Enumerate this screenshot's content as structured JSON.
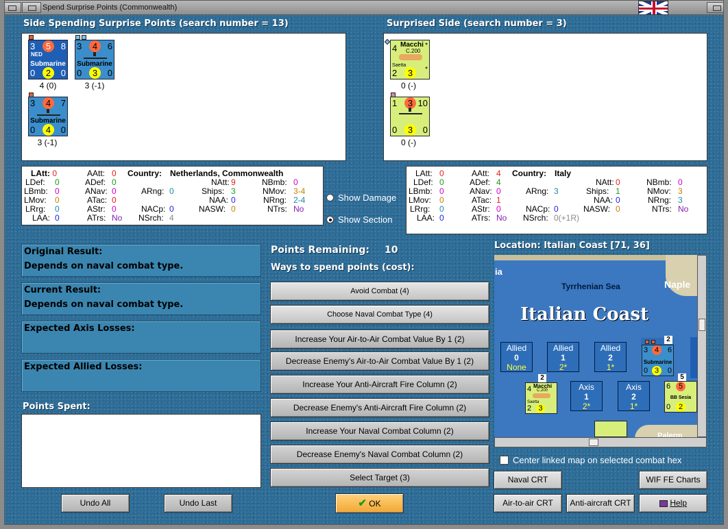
{
  "window": {
    "title": "Spend Surprise Points (Commonwealth)"
  },
  "left": {
    "header": "Side Spending Surprise Points (search number = 13)",
    "units": [
      {
        "tl": "3",
        "tc": "5",
        "tr": "8",
        "bl": "0",
        "bc": "2",
        "br": "0",
        "tag": "NED",
        "name": "Submarine",
        "label": "4 (0)"
      },
      {
        "tl": "3",
        "tc": "4",
        "tr": "6",
        "bl": "0",
        "bc": "3",
        "br": "0",
        "tag": "",
        "name": "Submarine",
        "label": "3 (-1)"
      },
      {
        "tl": "3",
        "tc": "4",
        "tr": "7",
        "bl": "0",
        "bc": "4",
        "br": "0",
        "tag": "",
        "name": "Submarine",
        "label": "3 (-1)"
      }
    ]
  },
  "right": {
    "header": "Surprised Side (search number = 3)",
    "units": [
      {
        "tl": "4",
        "name": "Macchi",
        "model": "C.200",
        "sub": "Saetta",
        "bl": "2",
        "bc": "3",
        "star": "*",
        "label": "0 (-)"
      },
      {
        "tl": "1",
        "tc": "3",
        "tr": "10",
        "bl": "0",
        "bc": "3",
        "br": "0",
        "label": "0 (-)"
      }
    ]
  },
  "statsLeft": {
    "country_label": "Country:",
    "country": "Netherlands, Commonwealth",
    "rows": [
      {
        "k": "LAtt:",
        "v": "0"
      },
      {
        "k": "LDef:",
        "v": "0"
      },
      {
        "k": "LBmb:",
        "v": "0"
      },
      {
        "k": "LMov:",
        "v": "0"
      },
      {
        "k": "LRrg:",
        "v": "0"
      },
      {
        "k": "LAA:",
        "v": "0"
      },
      {
        "k": "AAtt:",
        "v": "0"
      },
      {
        "k": "ADef:",
        "v": "0"
      },
      {
        "k": "ANav:",
        "v": "0"
      },
      {
        "k": "ATac:",
        "v": "0"
      },
      {
        "k": "AStr:",
        "v": "0"
      },
      {
        "k": "ATrs:",
        "v": "No"
      },
      {
        "k": "ARng:",
        "v": "0"
      },
      {
        "k": "NACp:",
        "v": "0"
      },
      {
        "k": "NSrch:",
        "v": "4"
      },
      {
        "k": "NAtt:",
        "v": "9"
      },
      {
        "k": "Ships:",
        "v": "3"
      },
      {
        "k": "NAA:",
        "v": "0"
      },
      {
        "k": "NASW:",
        "v": "0"
      },
      {
        "k": "NBmb:",
        "v": "0"
      },
      {
        "k": "NMov:",
        "v": "3-4"
      },
      {
        "k": "NRng:",
        "v": "2-4"
      },
      {
        "k": "NTrs:",
        "v": "No"
      }
    ]
  },
  "statsRight": {
    "country_label": "Country:",
    "country": "Italy",
    "rows": [
      {
        "k": "LAtt:",
        "v": "0"
      },
      {
        "k": "LDef:",
        "v": "0"
      },
      {
        "k": "LBmb:",
        "v": "0"
      },
      {
        "k": "LMov:",
        "v": "0"
      },
      {
        "k": "LRrg:",
        "v": "0"
      },
      {
        "k": "LAA:",
        "v": "0"
      },
      {
        "k": "AAtt:",
        "v": "4"
      },
      {
        "k": "ADef:",
        "v": "4"
      },
      {
        "k": "ANav:",
        "v": "0"
      },
      {
        "k": "ATac:",
        "v": "1"
      },
      {
        "k": "AStr:",
        "v": "0"
      },
      {
        "k": "ATrs:",
        "v": "No"
      },
      {
        "k": "ARng:",
        "v": "3"
      },
      {
        "k": "NACp:",
        "v": "0"
      },
      {
        "k": "NSrch:",
        "v": "0(+1R)"
      },
      {
        "k": "NAtt:",
        "v": "0"
      },
      {
        "k": "Ships:",
        "v": "1"
      },
      {
        "k": "NAA:",
        "v": "0"
      },
      {
        "k": "NASW:",
        "v": "0"
      },
      {
        "k": "NBmb:",
        "v": "0"
      },
      {
        "k": "NMov:",
        "v": "3"
      },
      {
        "k": "NRng:",
        "v": "3"
      },
      {
        "k": "NTrs:",
        "v": "No"
      }
    ]
  },
  "options": {
    "show_damage": "Show Damage",
    "show_section": "Show Section"
  },
  "results": [
    {
      "title": "Original Result:",
      "value": "Depends on naval combat type."
    },
    {
      "title": "Current Result:",
      "value": "Depends on naval combat type."
    },
    {
      "title": "Expected Axis Losses:",
      "value": ""
    },
    {
      "title": "Expected Allied Losses:",
      "value": ""
    }
  ],
  "points_spent_label": "Points Spent:",
  "points": {
    "label": "Points Remaining:",
    "value": "10",
    "ways": "Ways to spend points (cost):"
  },
  "spend_buttons": [
    "Avoid Combat (4)",
    "Choose Naval Combat Type (4)",
    "Increase Your Air-to-Air Combat Value By 1 (2)",
    "Decrease Enemy's Air-to-Air Combat Value By 1 (2)",
    "Increase Your Anti-Aircraft Fire Column (2)",
    "Decrease Enemy's Anti-Aircraft Fire Column (2)",
    "Increase Your Naval Combat Column (2)",
    "Decrease Enemy's Naval Combat Column (2)",
    "Select Target (3)"
  ],
  "undo_all": "Undo All",
  "undo_last": "Undo Last",
  "ok": "OK",
  "location": "Location: Italian Coast [71, 36]",
  "map": {
    "title": "Italian Coast",
    "sea": "Tyrrhenian Sea",
    "city": "Naple",
    "edge": "ia",
    "city2": "Palerm",
    "allied": [
      {
        "t": "Allied",
        "n": "0",
        "s": "None"
      },
      {
        "t": "Allied",
        "n": "1",
        "s": "2*"
      },
      {
        "t": "Allied",
        "n": "2",
        "s": "1*"
      }
    ],
    "axis": [
      {
        "t": "Axis",
        "n": "1",
        "s": "2*"
      },
      {
        "t": "Axis",
        "n": "2",
        "s": "1*"
      }
    ],
    "stack1": "2",
    "stack2": "2",
    "stack3": "5",
    "mini_sub": {
      "tl": "3",
      "tc": "4",
      "tr": "6",
      "bl": "0",
      "bc": "3",
      "br": "0",
      "name": "Submarine"
    },
    "mini_mac": {
      "tl": "4",
      "name": "Macchi",
      "model": "C.200",
      "sub": "Saetta",
      "bl": "2",
      "bc": "3"
    },
    "mini_ship": {
      "tl": "6",
      "tc": "5",
      "name": "BB Sesia",
      "bl": "0",
      "bc": "2"
    }
  },
  "center_check": "Center linked map on selected combat hex",
  "crt_buttons": {
    "naval": "Naval CRT",
    "wif": "WIF FE Charts",
    "air": "Air-to-air CRT",
    "aa": "Anti-aircraft CRT",
    "help": "Help"
  }
}
